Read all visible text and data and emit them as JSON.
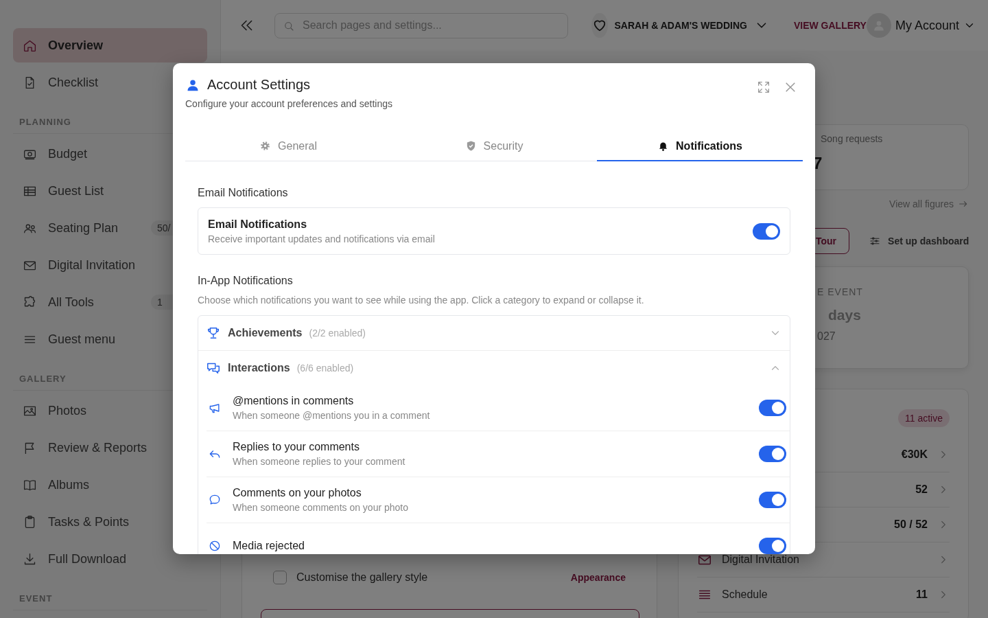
{
  "sidebar": {
    "items": [
      {
        "kind": "link",
        "label": "Overview",
        "selected": true
      },
      {
        "kind": "link",
        "label": "Checklist",
        "selected": false
      },
      {
        "kind": "heading",
        "label": "PLANNING"
      },
      {
        "kind": "link",
        "label": "Budget",
        "selected": false
      },
      {
        "kind": "link",
        "label": "Guest List",
        "selected": false
      },
      {
        "kind": "link",
        "label": "Seating Plan",
        "selected": false,
        "badge": "50/"
      },
      {
        "kind": "link",
        "label": "Digital Invitation",
        "selected": false
      },
      {
        "kind": "link",
        "label": "All Tools",
        "selected": false,
        "badge": "1"
      },
      {
        "kind": "link",
        "label": "Guest menu",
        "selected": false
      },
      {
        "kind": "heading",
        "label": "GALLERY"
      },
      {
        "kind": "link",
        "label": "Photos",
        "selected": false
      },
      {
        "kind": "link",
        "label": "Review & Reports",
        "selected": false
      },
      {
        "kind": "link",
        "label": "Albums",
        "selected": false
      },
      {
        "kind": "link",
        "label": "Tasks & Points",
        "selected": false
      },
      {
        "kind": "link",
        "label": "Full Download",
        "selected": false
      },
      {
        "kind": "heading",
        "label": "EVENT"
      }
    ]
  },
  "topbar": {
    "search": {
      "placeholder": "Search pages and settings..."
    },
    "event": "SARAH & ADAM'S WEDDING",
    "gallery_link": "VIEW GALLERY",
    "account": "My Account"
  },
  "dashboard": {
    "stat_card": {
      "value": "7",
      "label": "Song requests"
    },
    "figures_link": "View all figures",
    "tour_button": "Tour",
    "setup_button": "Set up dashboard",
    "countdown": {
      "label": "E EVENT",
      "unit": "days",
      "date": "027"
    },
    "overview_card": {
      "badge": "11 active",
      "rows": [
        {
          "value": "€30K"
        },
        {
          "value": "52"
        },
        {
          "value": "50 / 52"
        },
        {
          "label": "Digital Invitation"
        },
        {
          "label": "Schedule",
          "value": "11"
        }
      ]
    },
    "task_card": {
      "tasks": [
        {
          "label": "Customise the gallery style",
          "checked": false,
          "action": "Appearance"
        }
      ]
    }
  },
  "modal": {
    "title": "Account Settings",
    "subtitle": "Configure your account preferences and settings",
    "tabs": [
      {
        "label": "General",
        "selected": false
      },
      {
        "label": "Security",
        "selected": false
      },
      {
        "label": "Notifications",
        "selected": true
      }
    ],
    "email_section": {
      "heading": "Email Notifications",
      "items": [
        {
          "title": "Email Notifications",
          "description": "Receive important updates and notifications via email",
          "on": true
        }
      ]
    },
    "inapp_section": {
      "heading": "In-App Notifications",
      "description": "Choose which notifications you want to see while using the app. Click a category to expand or collapse it.",
      "categories": [
        {
          "name": "Achievements",
          "count": "(2/2 enabled)",
          "expanded": false
        },
        {
          "name": "Interactions",
          "count": "(6/6 enabled)",
          "expanded": true,
          "items": [
            {
              "title": "@mentions in comments",
              "description": "When someone @mentions you in a comment",
              "on": true
            },
            {
              "title": "Replies to your comments",
              "description": "When someone replies to your comment",
              "on": true
            },
            {
              "title": "Comments on your photos",
              "description": "When someone comments on your photo",
              "on": true
            },
            {
              "title": "Media rejected",
              "on": true
            }
          ]
        }
      ]
    }
  }
}
